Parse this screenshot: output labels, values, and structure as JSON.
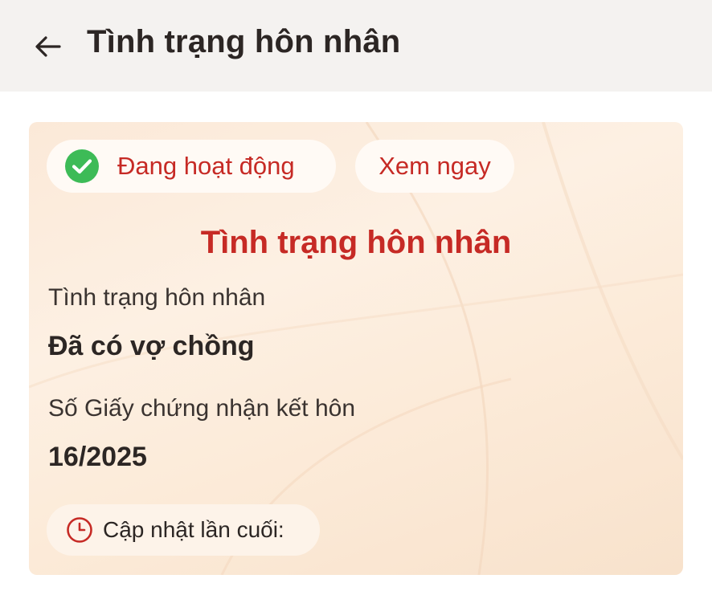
{
  "header": {
    "title": "Tình trạng hôn nhân",
    "back_icon": "arrow-left-icon"
  },
  "card": {
    "status_label": "Đang hoạt động",
    "status_icon": "check-circle-icon",
    "view_label": "Xem ngay",
    "title": "Tình trạng hôn nhân",
    "fields": [
      {
        "label": "Tình trạng hôn nhân",
        "value": "Đã có vợ chồng"
      },
      {
        "label": "Số Giấy chứng nhận kết hôn",
        "value": "16/2025"
      }
    ],
    "last_updated_label": "Cập nhật lần cuối:",
    "last_updated_icon": "clock-icon"
  },
  "colors": {
    "accent_red": "#c62a25",
    "status_green": "#3dbb57",
    "header_bg": "#f4f2f0",
    "text_dark": "#2c2624"
  }
}
